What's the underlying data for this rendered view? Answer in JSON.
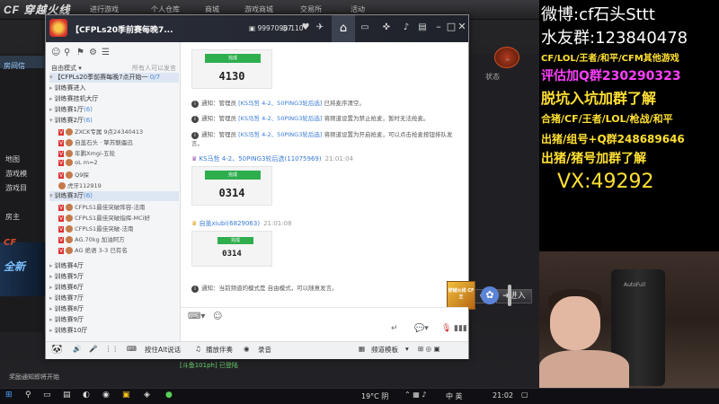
{
  "game": {
    "logo": "CF 穿越火线",
    "tabs": [
      "进行游戏",
      "个人仓库",
      "商城",
      "游戏商城",
      "交易所",
      "活动"
    ],
    "room_label": "房间信",
    "sidebar_items": [
      "地图",
      "游戏模",
      "游戏目",
      "房主"
    ],
    "status_header": "状态",
    "banner_text": "全新",
    "enter_button": "进入",
    "bottom_chat": "[斗鱼101ph] 已登陆",
    "footer_notice": "奖励通知即将开始"
  },
  "chat_window": {
    "group_name": "【CFPLs20季前赛每晚7...",
    "group_id": "99970987",
    "member_count": "110",
    "panel_mode": "自由模式",
    "panel_allow": "所有人可以发言",
    "channels": [
      {
        "label": "【CFPLs20季前赛每晚7点开始一",
        "count": "0/7"
      },
      {
        "label": "训练赛进入",
        "count": ""
      },
      {
        "label": "训练赛挂机大厅",
        "count": ""
      },
      {
        "label": "训练赛1厅",
        "count": "(6)"
      },
      {
        "label": "训练赛2厅",
        "count": "(6)"
      }
    ],
    "members_group1": [
      "ZXCK专属 9点24340413",
      "自盖石头 · 擎苏魅儡迅",
      "年鹏Xmgi-五轮",
      "oL m=2",
      "Q9探"
    ],
    "member_group1_extra": "虎牙112919",
    "channel_3": {
      "label": "训练赛3厅",
      "count": "(6)"
    },
    "members_group3": [
      "CFPLS1最佳突破阵容-法南",
      "CFPLS1最佳突破指挥-MCi好",
      "CFPLS1最佳突破-法南",
      "AG.70kg",
      "AG 绝语 3-3"
    ],
    "member_group3_extra1": "加油阿方",
    "member_group3_extra2": "已有名",
    "channels_rest": [
      "训练赛4厅",
      "训练赛5厅",
      "训练赛6厅",
      "训练赛7厅",
      "训练赛8厅",
      "训练赛9厅",
      "训练赛10厅"
    ],
    "toolbar": {
      "hold_speak": "按住Alt说话",
      "broadcast": "播放伴奏",
      "record": "录音",
      "channel_template": "频道模板"
    },
    "messages": {
      "code1_btn": "完成",
      "code1": "4130",
      "notice1_prefix": "通知：管理员",
      "notice1_link": "[KS马哲 4-2、50PING3轮后选]",
      "notice1_suffix": "已将麦序清空。",
      "notice2_prefix": "通知：管理员",
      "notice2_link": "[KS马哲 4-2、50PING3轮后选]",
      "notice2_suffix": "将频道设置为禁止抢麦，暂时无法抢麦。",
      "notice3_prefix": "通知：管理员",
      "notice3_link": "[KS马哲 4-2、50PING3轮后选]",
      "notice3_suffix": "将频道设置为开启抢麦，可以点击抢麦按钮排队发言。",
      "sender1": "KS马哲 4-2、50PING3轮后选(11075969)",
      "sender1_time": "21:01:04",
      "code2_btn": "完成",
      "code2": "0314",
      "sender2": "自盖xiubi(6829063)",
      "sender2_time": "21:01:08",
      "code3_btn": "完成",
      "code3": "0314",
      "notice4": "通知：当前频道的模式是 自由模式，可以随意发言。",
      "promo_text": "穿越火线 CF 王"
    }
  },
  "overlay": {
    "line1": "微博:cf石头Sttt",
    "line2": "水友群:123840478",
    "line3": "CF/LOL/王者/和平/CFM其他游戏",
    "line4": "评估加Q群230290323",
    "line5": "脱坑入坑加群了解",
    "line6": "合猪/CF/王者/LOL/枪战/和平",
    "line7": "出猪/组号+Q群248689646",
    "line8": "出猪/猪号加群了解",
    "line9": "VX:49292",
    "chair_brand": "AutoFull"
  },
  "taskbar": {
    "weather": "19°C 阴",
    "ime": "中 英",
    "time": "21:02"
  }
}
